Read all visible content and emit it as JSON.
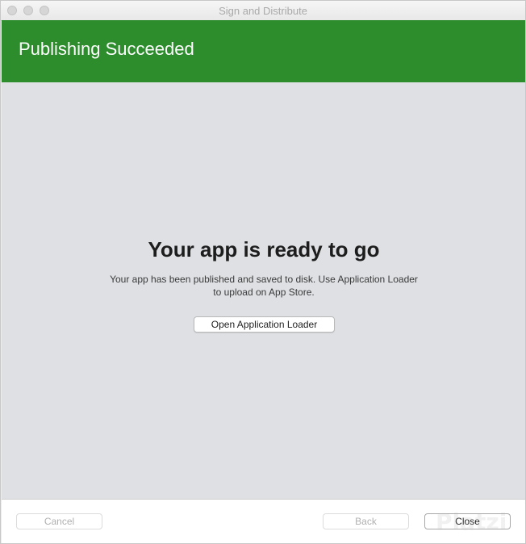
{
  "window": {
    "title": "Sign and Distribute"
  },
  "header": {
    "title": "Publishing Succeeded",
    "color": "#2d8d2d"
  },
  "main": {
    "title": "Your app is ready to go",
    "subtitle_line1": "Your app has been published and saved to disk. Use Application Loader",
    "subtitle_line2": "to upload on App Store.",
    "open_button_label": "Open Application Loader"
  },
  "footer": {
    "cancel_label": "Cancel",
    "back_label": "Back",
    "close_label": "Close"
  },
  "watermark": {
    "text": "Platzi"
  }
}
